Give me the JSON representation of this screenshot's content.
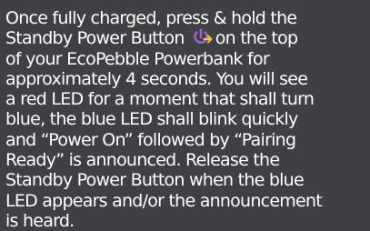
{
  "instructions": {
    "lines": [
      "Once fully charged, press & hold the",
      "Standby Power Button",
      "on the top",
      "of your EcoPebble Powerbank for",
      "approximately 4 seconds. You will see",
      "a red LED for a moment that shall turn",
      "blue, the blue LED shall blink quickly",
      "and “Power On” followed by “Pairing",
      "Ready” is announced. Release the",
      "Standby Power Button when the blue",
      "LED appears and/or the announcement",
      "is heard."
    ],
    "icon": "standby-power-icon",
    "icon_colors": {
      "primary": "#a35fd0",
      "secondary": "#f4c430"
    }
  }
}
